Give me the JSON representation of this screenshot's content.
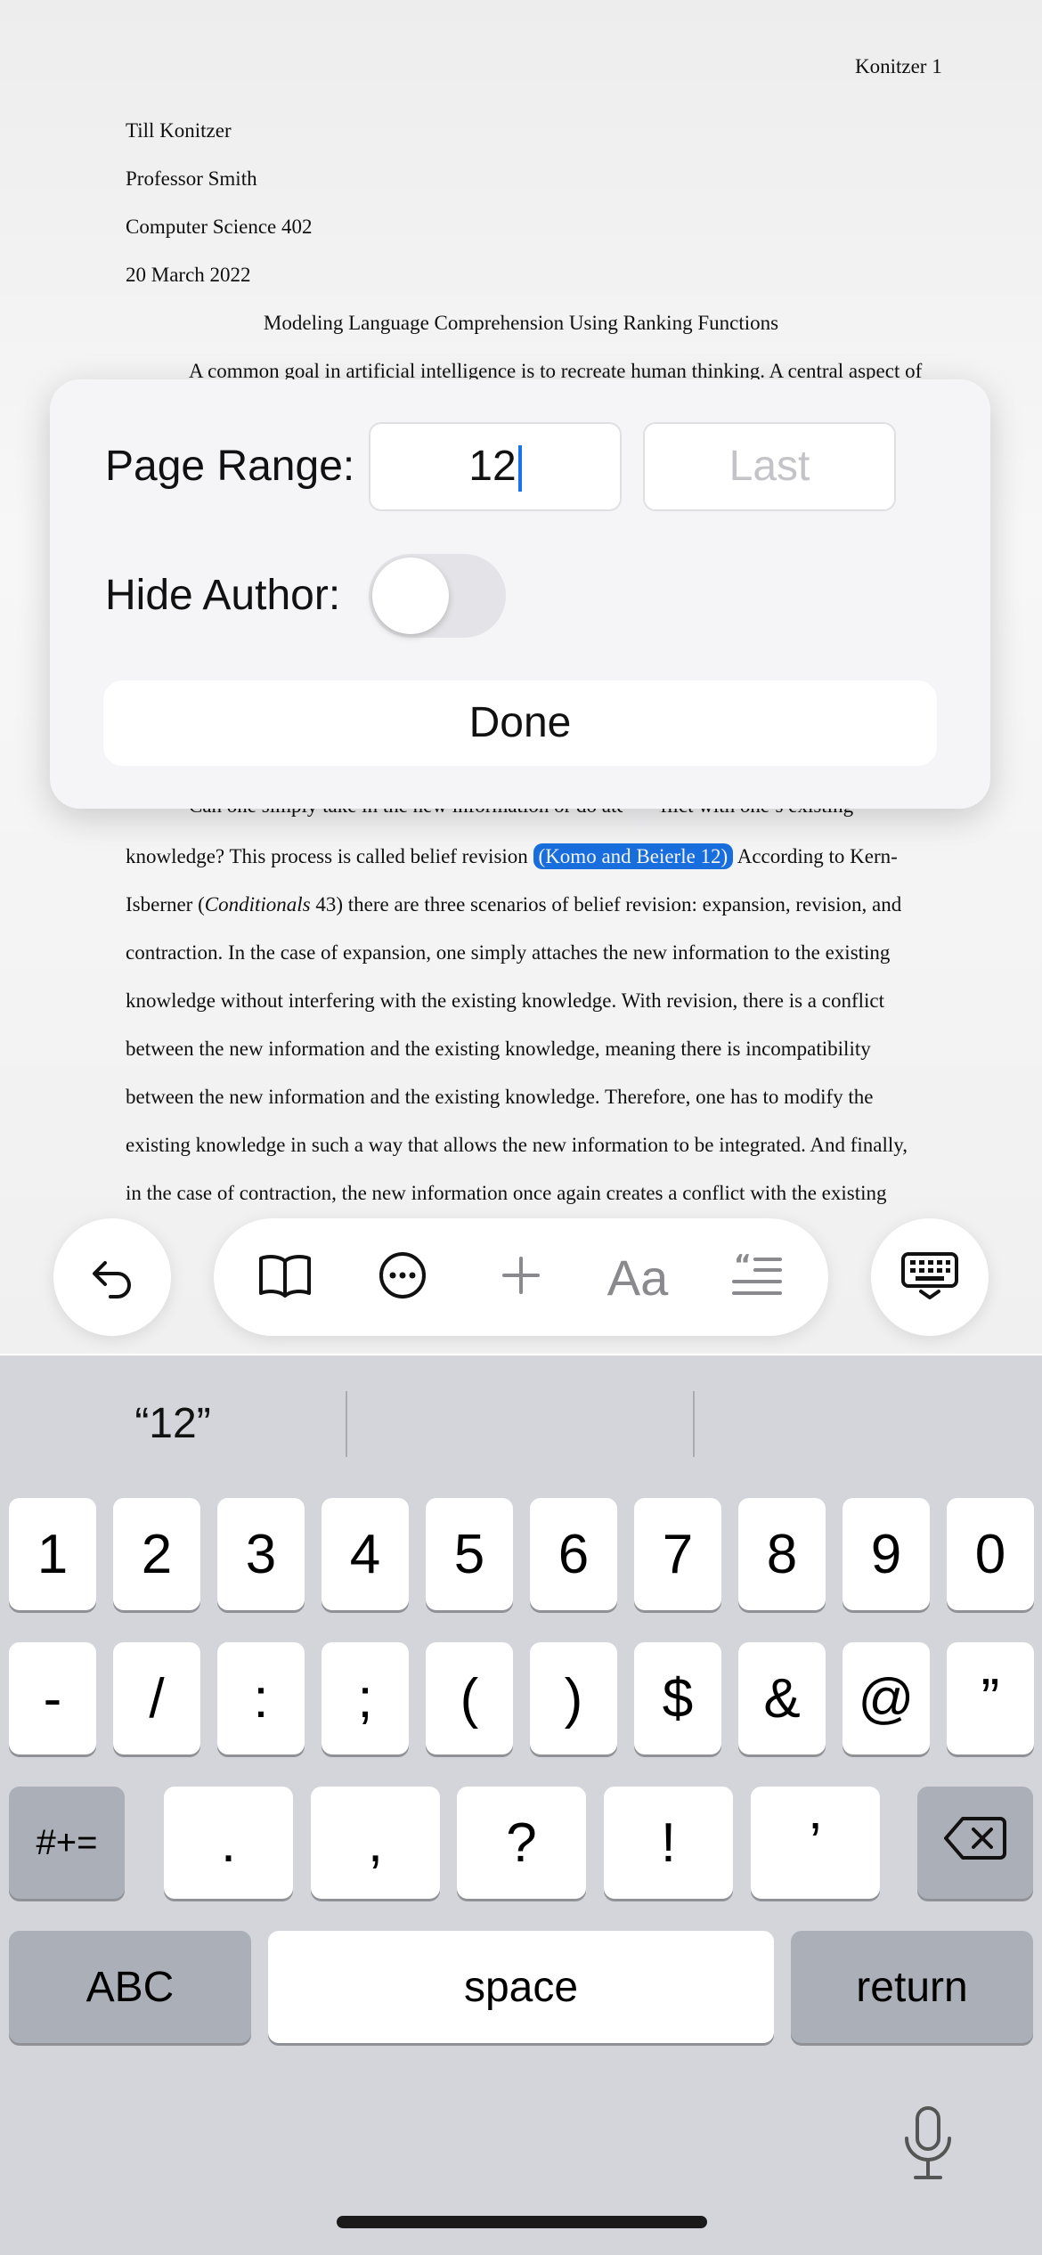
{
  "document": {
    "header_right": "Konitzer 1",
    "author": "Till Konitzer",
    "professor": "Professor Smith",
    "course": "Computer Science 402",
    "date": "20 March 2022",
    "title": "Modeling Language Comprehension Using Ranking Functions",
    "para1_line1": "A common goal in artificial intelligence is to recreate human thinking. A central aspect of",
    "para2_line_partial": "Can one simply take in the new information or do        ate conflict with one’s existing",
    "line_belief_pre": "knowledge? This process is called belief revision",
    "line_belief_cite": "(Komo and Beierle 12)",
    "line_belief_post": "According to Kern-",
    "line_isberner_pre": "Isberner (",
    "line_isberner_italic": "Conditionals",
    "line_isberner_post": " 43) there are three scenarios of belief revision: expansion, revision, and",
    "body_lines": [
      "contraction. In the case of expansion, one simply attaches the new information to the existing",
      "knowledge without interfering with the existing knowledge. With revision, there is a conflict",
      "between the new information and the existing knowledge, meaning there is incompatibility",
      "between the new information and the existing knowledge. Therefore, one has to modify the",
      "existing knowledge in such a way that allows the new information to be integrated. And finally,",
      "in the case of contraction, the new information once again creates a conflict with the existing"
    ]
  },
  "popover": {
    "page_range_label": "Page Range:",
    "page_range_start": "12",
    "page_range_end_placeholder": "Last",
    "hide_author_label": "Hide Author:",
    "hide_author_on": false,
    "done_label": "Done"
  },
  "toolbar": {
    "undo_icon": "undo-arrow-icon",
    "book_icon": "book-icon",
    "more_icon": "ellipsis-circle-icon",
    "add_icon": "plus-icon",
    "font_label": "Aa",
    "citation_icon": "quote-list-icon",
    "keyboard_icon": "keyboard-dismiss-icon"
  },
  "keyboard": {
    "suggestions": [
      "“12”",
      "",
      ""
    ],
    "row1": [
      "1",
      "2",
      "3",
      "4",
      "5",
      "6",
      "7",
      "8",
      "9",
      "0"
    ],
    "row2": [
      "-",
      "/",
      ":",
      ";",
      "(",
      ")",
      "$",
      "&",
      "@",
      "”"
    ],
    "row3_shift": "#+=",
    "row3": [
      ".",
      ",",
      "?",
      "!",
      "’"
    ],
    "abc_label": "ABC",
    "space_label": "space",
    "return_label": "return"
  },
  "colors": {
    "accent": "#1a73e8",
    "keyboard_bg": "#d3d5db",
    "key_dark": "#abafb8"
  }
}
